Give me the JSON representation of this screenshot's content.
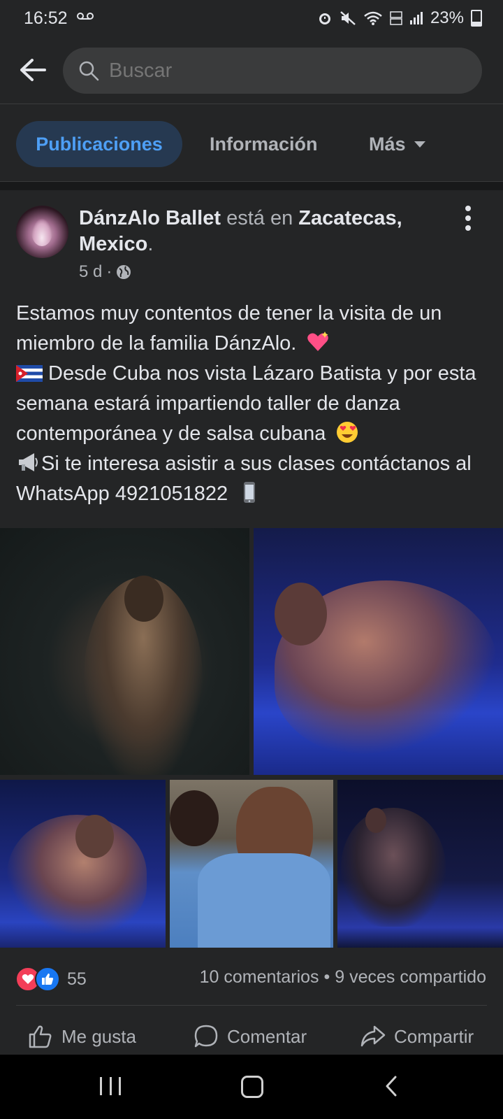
{
  "status_bar": {
    "time": "16:52",
    "battery": "23%"
  },
  "search": {
    "placeholder": "Buscar"
  },
  "tabs": [
    {
      "label": "Publicaciones",
      "active": true
    },
    {
      "label": "Información"
    },
    {
      "label": "Más"
    }
  ],
  "post": {
    "author": "DánzAlo Ballet",
    "connector": "está en",
    "location": "Zacatecas, Mexico",
    "time": "5 d",
    "text": {
      "line1": "Estamos muy contentos de tener la visita de un miembro de la familia DánzAlo.",
      "line2": "Desde Cuba nos vista Lázaro Batista y por esta semana estará impartiendo taller de danza contemporánea y de salsa cubana",
      "line3": "Si te interesa asistir a sus clases contáctanos al WhatsApp 4921051822"
    },
    "reactions_count": "55",
    "comments": "10 comentarios",
    "shares": "9 veces compartido"
  },
  "actions": {
    "like": "Me gusta",
    "comment": "Comentar",
    "share": "Compartir"
  },
  "colors": {
    "background": "#18191a",
    "surface": "#242526",
    "accent": "#4e9ff5",
    "love": "#f33e58",
    "like": "#1877f2"
  },
  "icons": [
    "back-arrow-icon",
    "search-icon",
    "globe-icon",
    "more-vertical-icon",
    "heart-icon",
    "thumbs-up-icon",
    "comment-icon",
    "share-icon",
    "sparkling-heart-emoji",
    "cuba-flag-emoji",
    "heart-eyes-emoji",
    "megaphone-emoji",
    "mobile-phone-emoji"
  ]
}
